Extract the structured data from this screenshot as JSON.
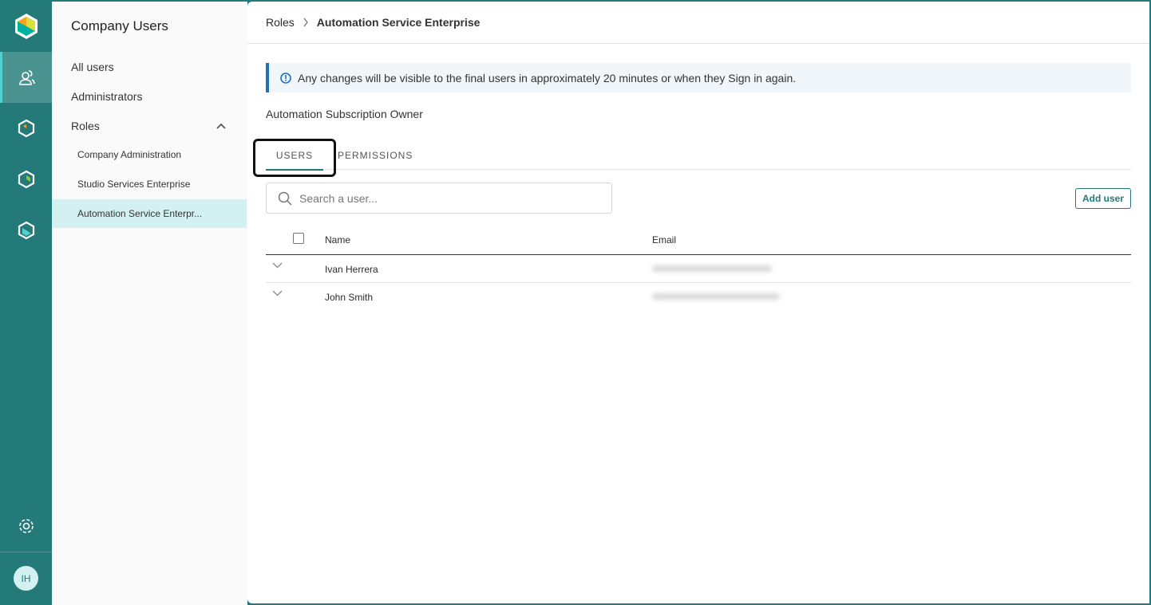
{
  "rail": {
    "items": [
      "users-icon",
      "product-a-icon",
      "product-b-icon",
      "product-c-icon"
    ],
    "settings": "gear-icon",
    "avatar_initials": "IH",
    "accent": "#237a78"
  },
  "sidebar": {
    "title": "Company Users",
    "items": [
      {
        "label": "All users"
      },
      {
        "label": "Administrators"
      },
      {
        "label": "Roles"
      }
    ],
    "roles": [
      {
        "label": "Company Administration"
      },
      {
        "label": "Studio Services Enterprise"
      },
      {
        "label": "Automation Service Enterpr..."
      }
    ]
  },
  "breadcrumb": {
    "parent": "Roles",
    "current": "Automation Service Enterprise"
  },
  "notice": "Any changes will be visible to the final users in approximately 20 minutes or when they Sign in again.",
  "role_subtitle": "Automation Subscription Owner",
  "tabs": [
    {
      "label": "USERS"
    },
    {
      "label": "PERMISSIONS"
    }
  ],
  "search": {
    "placeholder": "Search a user..."
  },
  "add_user": "Add user",
  "table": {
    "headers": {
      "name": "Name",
      "email": "Email"
    },
    "rows": [
      {
        "name": "Ivan Herrera"
      },
      {
        "name": "John Smith"
      }
    ]
  }
}
